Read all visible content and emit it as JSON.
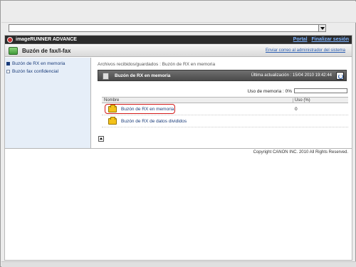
{
  "browser": {
    "address_value": ""
  },
  "app": {
    "name": "imageRUNNER ADVANCE",
    "top_links": [
      "Portal",
      "Finalizar sesión"
    ]
  },
  "title_bar": {
    "title": "Buzón de fax/I-fax",
    "admin_link": "Enviar correo al administrador del sistema"
  },
  "sidebar": {
    "items": [
      {
        "label": "Buzón de RX en memoria",
        "active": true
      },
      {
        "label": "Buzón fax confidencial",
        "active": false
      }
    ]
  },
  "main": {
    "breadcrumb": "Archivos recibidos/guardados : Buzón de RX en memoria",
    "section_title": "Buzón de RX en memoria",
    "last_update": "Última actualización : 15/04 2010 19:42:44",
    "memory_usage_label": "Uso de memoria : 0%",
    "memory_usage_fraction": 0,
    "table": {
      "columns": [
        "Nombre",
        "Uso (%)"
      ],
      "rows": [
        {
          "name": "Buzón de RX en memoria",
          "usage": "0",
          "highlighted": true
        },
        {
          "name": "Buzón de RX de datos divididos",
          "usage": "",
          "highlighted": false
        }
      ]
    }
  },
  "footer": {
    "copyright": "Copyright CANON INC. 2010 All Rights Reserved."
  },
  "colors": {
    "app_bar": "#2b2b2b",
    "link": "#1a3c7a",
    "highlight": "#d21a1a",
    "folder": "#f3c21a",
    "sidebar_bg": "#e6eef8"
  },
  "icons": {
    "app_logo": "canon-logo-icon",
    "title": "fax-box-icon",
    "section": "memory-box-icon",
    "refresh": "refresh-icon",
    "row": "folder-icon",
    "scroll": "scroll-up-icon"
  }
}
